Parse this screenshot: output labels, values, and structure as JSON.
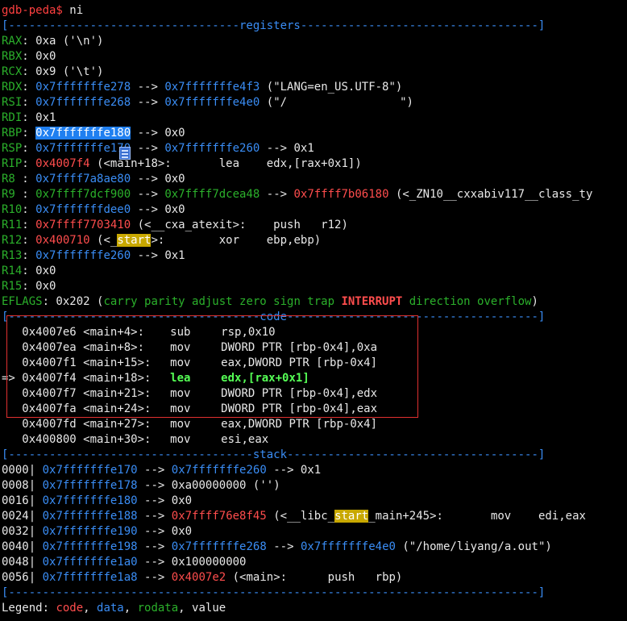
{
  "prompt": {
    "text": "gdb-peda$",
    "command": " ni"
  },
  "headers": {
    "registers": "[----------------------------------registers-----------------------------------]",
    "code": "[-------------------------------------code-------------------------------------]",
    "stack": "[------------------------------------stack-------------------------------------]",
    "end": "[------------------------------------------------------------------------------]"
  },
  "registers": [
    {
      "name": "RAX",
      "parts": [
        ": 0xa ('\\n')"
      ]
    },
    {
      "name": "RBX",
      "parts": [
        ": 0x0"
      ]
    },
    {
      "name": "RCX",
      "parts": [
        ": 0x9 ('\\t')"
      ]
    },
    {
      "name": "RDX",
      "a": "0x7fffffffe278",
      "arrow": " --> ",
      "b": "0x7fffffffe4f3",
      "tail": " (\"LANG=en_US.UTF-8\")"
    },
    {
      "name": "RSI",
      "a": "0x7fffffffe268",
      "arrow": " --> ",
      "b": "0x7fffffffe4e0",
      "tail": " (\"/",
      "tail2": "\")"
    },
    {
      "name": "RDI",
      "parts": [
        ": 0x1"
      ]
    },
    {
      "name": "RBP",
      "a": "0x7fffffffe180",
      "arrow": " --> 0x0"
    },
    {
      "name": "RSP",
      "a": "0x7fffffffe170",
      "arrow": " --> ",
      "b": "0x7fffffffe260",
      "tail": " --> 0x1"
    },
    {
      "name": "RIP",
      "a": "0x4007f4",
      "tail": " (<main+18>:       lea    edx,[rax+0x1])"
    },
    {
      "name": "R8 ",
      "a": "0x7ffff7a8ae80",
      "tail": " --> 0x0"
    },
    {
      "name": "R9 ",
      "a": "0x7ffff7dcf900",
      "arrow": " --> ",
      "b": "0x7ffff7dcea48",
      "arrow2": " --> ",
      "c": "0x7ffff7b06180",
      "tail": " (<_ZN10__cxxabiv117__class_ty"
    },
    {
      "name": "R10",
      "a": "0x7fffffffdee0",
      "tail": " --> 0x0"
    },
    {
      "name": "R11",
      "a": "0x7ffff7703410",
      "tail": " (<__cxa_atexit>:    push   r12)"
    },
    {
      "name": "R12",
      "a": "0x400710",
      "pre": " (<_",
      "hl": "start",
      "tail": ">:        xor    ebp,ebp)"
    },
    {
      "name": "R13",
      "a": "0x7fffffffe260",
      "tail": " --> 0x1"
    },
    {
      "name": "R14",
      "parts": [
        ": 0x0"
      ]
    },
    {
      "name": "R15",
      "parts": [
        ": 0x0"
      ]
    },
    {
      "name": "EFLAGS",
      "value": ": 0x202 (",
      "flags": "carry parity adjust zero sign trap",
      "int": "INTERRUPT",
      "flags2": "direction overflow",
      "close": ")"
    }
  ],
  "code": [
    {
      "prefix": "   ",
      "addr": "0x4007e6",
      "sym": "<main+4>:",
      "op": "sub",
      "args": "rsp,0x10"
    },
    {
      "prefix": "   ",
      "addr": "0x4007ea",
      "sym": "<main+8>:",
      "op": "mov",
      "args": "DWORD PTR [rbp-0x4],0xa"
    },
    {
      "prefix": "   ",
      "addr": "0x4007f1",
      "sym": "<main+15>:",
      "op": "mov",
      "args": "eax,DWORD PTR [rbp-0x4]"
    },
    {
      "prefix": "=> ",
      "addr": "0x4007f4",
      "sym": "<main+18>:",
      "op": "lea",
      "args": "edx,[rax+0x1]"
    },
    {
      "prefix": "   ",
      "addr": "0x4007f7",
      "sym": "<main+21>:",
      "op": "mov",
      "args": "DWORD PTR [rbp-0x4],edx"
    },
    {
      "prefix": "   ",
      "addr": "0x4007fa",
      "sym": "<main+24>:",
      "op": "mov",
      "args": "DWORD PTR [rbp-0x4],eax"
    },
    {
      "prefix": "   ",
      "addr": "0x4007fd",
      "sym": "<main+27>:",
      "op": "mov",
      "args": "eax,DWORD PTR [rbp-0x4]"
    },
    {
      "prefix": "   ",
      "addr": "0x400800",
      "sym": "<main+30>:",
      "op": "mov",
      "args": "esi,eax"
    }
  ],
  "stack": [
    {
      "off": "0000|",
      "a": "0x7fffffffe170",
      "arrow": " --> ",
      "b": "0x7fffffffe260",
      "tail": " --> 0x1"
    },
    {
      "off": "0008|",
      "a": "0x7fffffffe178",
      "arrow": " --> ",
      "tail": "0xa00000000 ('')"
    },
    {
      "off": "0016|",
      "a": "0x7fffffffe180",
      "arrow": " --> ",
      "tail": "0x0"
    },
    {
      "off": "0024|",
      "a": "0x7fffffffe188",
      "arrow": " --> ",
      "c": "0x7ffff76e8f45",
      "pre": " (<__libc_",
      "hl": "start",
      "tail": "_main+245>:       mov    edi,eax"
    },
    {
      "off": "0032|",
      "a": "0x7fffffffe190",
      "arrow": " --> ",
      "tail": "0x0"
    },
    {
      "off": "0040|",
      "a": "0x7fffffffe198",
      "arrow": " --> ",
      "b": "0x7fffffffe268",
      "arrow2": " --> ",
      "b2": "0x7fffffffe4e0",
      "tail": " (\"/home/liyang/a.out\")"
    },
    {
      "off": "0048|",
      "a": "0x7fffffffe1a0",
      "arrow": " --> ",
      "tail": "0x100000000"
    },
    {
      "off": "0056|",
      "a": "0x7fffffffe1a8",
      "arrow": " --> ",
      "c": "0x4007e2",
      "tail": " (<main>:      push   rbp)"
    }
  ],
  "legend": {
    "label": "Legend: ",
    "code": "code",
    "sep1": ", ",
    "data": "data",
    "sep2": ", ",
    "rodata": "rodata",
    "sep3": ", ",
    "value": "value"
  },
  "colors": {
    "background": "#000000",
    "register_name": "#2bb02b",
    "data_addr": "#3a8df5",
    "code_addr": "#ff4d4d",
    "current_line": "#55ff55",
    "highlight": "#1f7ff0",
    "match_highlight": "#c8a800",
    "annotation_box": "#e03030"
  }
}
